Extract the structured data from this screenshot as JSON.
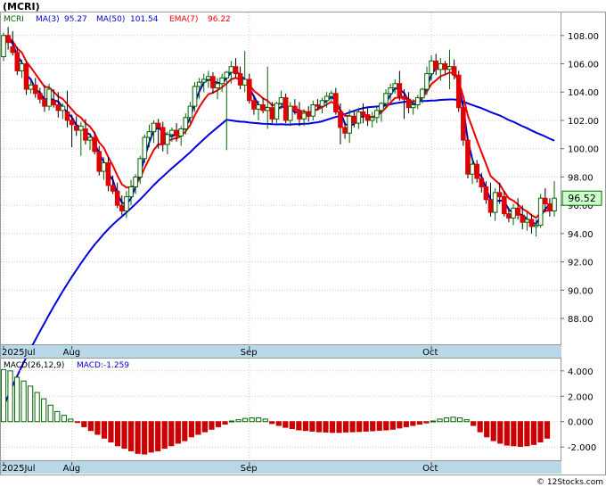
{
  "header": {
    "symbol": "(MCRI)",
    "ticker_label": "MCRI",
    "ma3_label": "MA(3)",
    "ma3_value": "95.27",
    "ma50_label": "MA(50)",
    "ma50_value": "101.54",
    "ema7_label": "EMA(7)",
    "ema7_value": "96.22"
  },
  "price_tag": "96.52",
  "macd_header": {
    "label": "MACD(26,12,9)",
    "value_label": "MACD:-1.259"
  },
  "watermark": "© 12Stocks.com",
  "colors": {
    "up": "#ffffff",
    "up_outline": "#006400",
    "down": "#e00000",
    "ma50": "#0000dd",
    "ma3": "#0000dd",
    "ema7": "#ee0000",
    "date_bar": "#b8d8e8",
    "tag_bg": "#ccffcc",
    "macd_pos": "#006600",
    "macd_neg": "#cc0000"
  },
  "chart_data": [
    {
      "type": "candlestick",
      "y_ticks": [
        "108.00",
        "106.00",
        "104.00",
        "102.00",
        "100.00",
        "98.00",
        "96.00",
        "94.00",
        "92.00",
        "90.00",
        "88.00"
      ],
      "ylim": [
        86.3,
        109.5
      ],
      "x_labels": [
        "2025Jul",
        "Aug",
        "Sep",
        "Oct"
      ],
      "label_index": [
        0,
        15,
        54,
        94
      ],
      "n": 122,
      "candles": [
        [
          106.5,
          108.2,
          106.2,
          108.0
        ],
        [
          108.0,
          108.6,
          107.0,
          107.5
        ],
        [
          107.2,
          108.3,
          106.6,
          106.8
        ],
        [
          106.8,
          107.2,
          105.2,
          105.5
        ],
        [
          105.5,
          106.3,
          105.0,
          106.0
        ],
        [
          106.0,
          106.2,
          103.8,
          104.2
        ],
        [
          104.2,
          104.8,
          103.9,
          104.5
        ],
        [
          104.5,
          105.0,
          103.6,
          103.9
        ],
        [
          103.9,
          104.3,
          103.2,
          103.5
        ],
        [
          103.5,
          104.5,
          102.6,
          103.0
        ],
        [
          103.0,
          104.6,
          102.7,
          104.2
        ],
        [
          103.4,
          104.2,
          102.9,
          103.1
        ],
        [
          103.1,
          104.0,
          102.2,
          102.7
        ],
        [
          102.7,
          103.2,
          102.1,
          103.0
        ],
        [
          102.6,
          104.1,
          101.5,
          102.0
        ],
        [
          102.0,
          102.4,
          100.1,
          101.7
        ],
        [
          101.6,
          102.3,
          100.9,
          101.3
        ],
        [
          101.3,
          101.9,
          99.5,
          101.6
        ],
        [
          101.4,
          102.1,
          100.3,
          100.6
        ],
        [
          100.6,
          101.1,
          99.9,
          100.8
        ],
        [
          100.8,
          101.2,
          99.6,
          99.8
        ],
        [
          99.8,
          100.2,
          98.1,
          98.4
        ],
        [
          98.4,
          99.4,
          97.8,
          99.0
        ],
        [
          99.0,
          99.4,
          97.0,
          97.4
        ],
        [
          97.4,
          98.1,
          96.8,
          97.0
        ],
        [
          97.0,
          97.6,
          95.8,
          96.0
        ],
        [
          96.0,
          96.7,
          95.3,
          95.6
        ],
        [
          95.6,
          97.0,
          95.1,
          96.6
        ],
        [
          96.6,
          97.8,
          96.0,
          97.3
        ],
        [
          97.3,
          98.2,
          96.8,
          98.0
        ],
        [
          98.0,
          99.5,
          97.5,
          99.3
        ],
        [
          99.3,
          101.0,
          99.0,
          100.8
        ],
        [
          100.8,
          101.7,
          100.1,
          101.2
        ],
        [
          101.2,
          102.0,
          100.4,
          101.8
        ],
        [
          101.8,
          102.1,
          100.0,
          101.5
        ],
        [
          101.5,
          101.9,
          99.8,
          100.3
        ],
        [
          100.3,
          101.2,
          99.6,
          101.0
        ],
        [
          101.0,
          101.5,
          100.5,
          101.3
        ],
        [
          101.3,
          101.8,
          100.5,
          100.9
        ],
        [
          100.9,
          101.6,
          100.2,
          101.4
        ],
        [
          101.4,
          102.5,
          101.0,
          102.2
        ],
        [
          102.2,
          103.3,
          101.8,
          103.0
        ],
        [
          103.0,
          104.7,
          102.6,
          104.4
        ],
        [
          104.4,
          105.0,
          103.5,
          104.7
        ],
        [
          104.7,
          105.3,
          104.0,
          104.9
        ],
        [
          104.9,
          105.5,
          104.3,
          105.1
        ],
        [
          105.1,
          105.4,
          103.9,
          104.3
        ],
        [
          104.3,
          105.0,
          103.5,
          104.6
        ],
        [
          104.6,
          105.3,
          104.0,
          105.0
        ],
        [
          105.0,
          105.5,
          99.9,
          105.4
        ],
        [
          105.4,
          106.2,
          104.6,
          105.8
        ],
        [
          105.8,
          106.4,
          105.0,
          105.3
        ],
        [
          105.3,
          105.8,
          104.2,
          104.5
        ],
        [
          104.5,
          106.9,
          104.0,
          104.9
        ],
        [
          104.9,
          105.3,
          103.2,
          103.4
        ],
        [
          103.4,
          103.8,
          102.4,
          102.8
        ],
        [
          102.8,
          103.4,
          102.0,
          103.1
        ],
        [
          103.1,
          103.6,
          102.5,
          102.7
        ],
        [
          102.7,
          105.8,
          101.4,
          102.9
        ],
        [
          102.9,
          103.3,
          101.8,
          102.1
        ],
        [
          102.1,
          103.3,
          101.7,
          103.2
        ],
        [
          103.2,
          104.1,
          102.8,
          103.6
        ],
        [
          103.6,
          103.9,
          101.8,
          102.0
        ],
        [
          102.0,
          103.3,
          101.6,
          103.0
        ],
        [
          103.0,
          103.5,
          102.4,
          102.7
        ],
        [
          102.7,
          103.3,
          101.6,
          102.1
        ],
        [
          102.1,
          102.8,
          101.6,
          102.5
        ],
        [
          102.5,
          103.0,
          101.9,
          102.3
        ],
        [
          102.3,
          103.4,
          102.0,
          103.1
        ],
        [
          103.1,
          103.5,
          102.7,
          103.0
        ],
        [
          103.0,
          103.6,
          102.5,
          103.4
        ],
        [
          103.4,
          104.0,
          102.9,
          103.7
        ],
        [
          103.7,
          104.1,
          103.4,
          103.9
        ],
        [
          103.9,
          104.3,
          102.4,
          102.6
        ],
        [
          102.6,
          103.2,
          100.3,
          101.5
        ],
        [
          101.5,
          101.9,
          100.7,
          101.1
        ],
        [
          101.1,
          102.8,
          100.4,
          102.3
        ],
        [
          102.3,
          102.7,
          101.5,
          101.8
        ],
        [
          101.8,
          102.9,
          101.4,
          102.6
        ],
        [
          102.6,
          103.2,
          101.8,
          102.4
        ],
        [
          102.4,
          102.9,
          101.6,
          102.0
        ],
        [
          102.0,
          102.6,
          101.5,
          102.2
        ],
        [
          102.2,
          103.0,
          101.8,
          102.7
        ],
        [
          102.7,
          103.3,
          101.9,
          103.2
        ],
        [
          103.2,
          104.2,
          102.9,
          103.9
        ],
        [
          103.9,
          104.6,
          103.4,
          104.3
        ],
        [
          104.3,
          104.9,
          103.9,
          104.6
        ],
        [
          104.6,
          105.5,
          103.4,
          103.7
        ],
        [
          103.7,
          104.2,
          102.1,
          103.5
        ],
        [
          103.5,
          104.0,
          102.5,
          102.9
        ],
        [
          102.9,
          103.5,
          102.4,
          103.1
        ],
        [
          103.1,
          103.8,
          102.8,
          103.6
        ],
        [
          103.6,
          104.3,
          103.2,
          104.2
        ],
        [
          104.2,
          105.8,
          103.8,
          105.3
        ],
        [
          105.3,
          106.6,
          104.8,
          106.2
        ],
        [
          106.2,
          106.7,
          105.2,
          105.6
        ],
        [
          105.6,
          106.4,
          104.8,
          106.0
        ],
        [
          106.0,
          106.2,
          105.3,
          105.6
        ],
        [
          105.6,
          107.0,
          104.2,
          105.8
        ],
        [
          105.8,
          106.3,
          104.9,
          105.2
        ],
        [
          105.2,
          105.5,
          102.6,
          102.9
        ],
        [
          102.9,
          103.3,
          100.2,
          100.6
        ],
        [
          100.6,
          100.9,
          97.9,
          98.2
        ],
        [
          98.2,
          99.4,
          97.5,
          98.9
        ],
        [
          98.9,
          99.2,
          97.6,
          97.9
        ],
        [
          97.9,
          98.3,
          96.9,
          97.3
        ],
        [
          97.3,
          97.7,
          96.1,
          96.4
        ],
        [
          96.4,
          97.6,
          95.2,
          95.5
        ],
        [
          95.5,
          97.2,
          94.9,
          96.9
        ],
        [
          96.9,
          97.6,
          96.1,
          96.6
        ],
        [
          96.6,
          97.0,
          95.2,
          95.4
        ],
        [
          95.4,
          95.8,
          94.8,
          95.1
        ],
        [
          95.1,
          96.1,
          94.6,
          95.8
        ],
        [
          95.8,
          96.5,
          95.0,
          95.3
        ],
        [
          95.3,
          96.0,
          94.3,
          94.8
        ],
        [
          94.8,
          95.5,
          94.2,
          95.0
        ],
        [
          95.0,
          95.4,
          94.0,
          94.5
        ],
        [
          94.5,
          95.0,
          93.8,
          94.6
        ],
        [
          94.6,
          96.8,
          94.4,
          96.5
        ],
        [
          96.5,
          97.2,
          95.5,
          96.1
        ],
        [
          96.1,
          96.5,
          95.2,
          95.6
        ],
        [
          95.6,
          97.7,
          95.2,
          96.5
        ]
      ]
    },
    {
      "type": "bar",
      "name": "MACD(26,12,9)",
      "y_ticks": [
        "4.000",
        "2.000",
        "0.000",
        "-2.000"
      ],
      "ylim": [
        -2.9,
        4.9
      ],
      "values": [
        4.1,
        4.0,
        3.5,
        3.2,
        2.8,
        2.3,
        1.8,
        1.3,
        0.8,
        0.5,
        0.2,
        -0.05,
        -0.4,
        -0.7,
        -1.0,
        -1.3,
        -1.6,
        -1.9,
        -2.1,
        -2.3,
        -2.5,
        -2.55,
        -2.4,
        -2.3,
        -2.1,
        -1.9,
        -1.7,
        -1.5,
        -1.2,
        -1.0,
        -0.8,
        -0.6,
        -0.4,
        -0.2,
        0.05,
        0.15,
        0.25,
        0.3,
        0.3,
        0.2,
        -0.15,
        -0.3,
        -0.45,
        -0.55,
        -0.65,
        -0.7,
        -0.75,
        -0.8,
        -0.82,
        -0.85,
        -0.85,
        -0.82,
        -0.8,
        -0.78,
        -0.75,
        -0.72,
        -0.68,
        -0.65,
        -0.6,
        -0.5,
        -0.4,
        -0.3,
        -0.2,
        -0.1,
        0.05,
        0.2,
        0.3,
        0.35,
        0.3,
        0.15,
        -0.3,
        -0.8,
        -1.2,
        -1.5,
        -1.7,
        -1.85,
        -1.9,
        -1.95,
        -1.9,
        -1.8,
        -1.6,
        -1.3
      ]
    }
  ]
}
